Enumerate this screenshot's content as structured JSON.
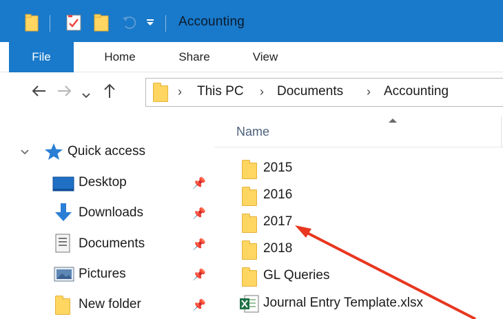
{
  "window": {
    "title": "Accounting",
    "quick_access_icons": [
      "folder-icon",
      "properties-icon",
      "new-folder-icon",
      "undo-icon",
      "customize-dropdown-icon"
    ]
  },
  "ribbon": {
    "tabs": [
      {
        "label": "File"
      },
      {
        "label": "Home"
      },
      {
        "label": "Share"
      },
      {
        "label": "View"
      }
    ]
  },
  "address_bar": {
    "crumbs": [
      "This PC",
      "Documents",
      "Accounting"
    ],
    "nav_icons": [
      "back-arrow-icon",
      "forward-arrow-icon",
      "recent-dropdown-icon",
      "up-arrow-icon"
    ]
  },
  "nav_pane": {
    "quick_access_label": "Quick access",
    "items": [
      {
        "label": "Desktop",
        "icon": "desktop-icon",
        "pinned": true
      },
      {
        "label": "Downloads",
        "icon": "download-icon",
        "pinned": true
      },
      {
        "label": "Documents",
        "icon": "documents-icon",
        "pinned": true
      },
      {
        "label": "Pictures",
        "icon": "pictures-icon",
        "pinned": true
      },
      {
        "label": "New folder",
        "icon": "folder-icon",
        "pinned": true
      }
    ]
  },
  "content": {
    "column_header": "Name",
    "files": [
      {
        "name": "2015",
        "type": "folder"
      },
      {
        "name": "2016",
        "type": "folder"
      },
      {
        "name": "2017",
        "type": "folder"
      },
      {
        "name": "2018",
        "type": "folder"
      },
      {
        "name": "GL Queries",
        "type": "folder"
      },
      {
        "name": "Journal Entry Template.xlsx",
        "type": "excel"
      }
    ]
  },
  "annotation": {
    "arrow_color": "#e8361f"
  }
}
